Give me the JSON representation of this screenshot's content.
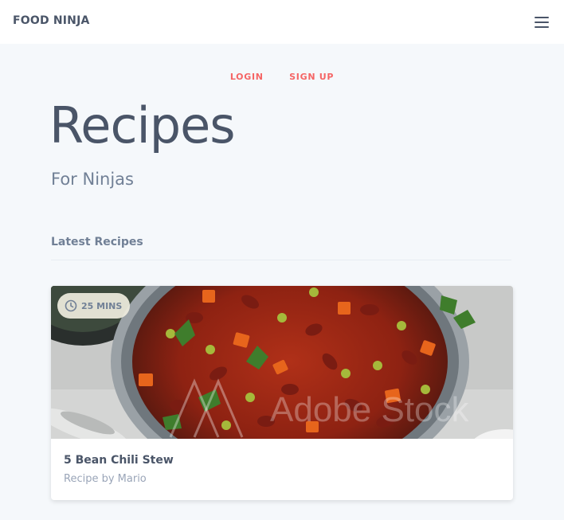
{
  "navbar": {
    "brand": "FOOD NINJA",
    "menu_icon": "hamburger-menu-icon"
  },
  "auth": {
    "login_label": "LOGIN",
    "signup_label": "SIGN UP"
  },
  "hero": {
    "title": "Recipes",
    "subtitle": "For Ninjas"
  },
  "section": {
    "heading": "Latest Recipes"
  },
  "recipes": [
    {
      "time": "25 MINS",
      "time_icon": "clock-icon",
      "title": "5 Bean Chili Stew",
      "author": "Recipe by Mario",
      "watermark": "Adobe Stock"
    }
  ],
  "colors": {
    "accent": "#f56565",
    "text_dark": "#4a5568",
    "text_muted": "#718096",
    "background": "#f5f8fb",
    "navbar_bg": "#ffffff"
  }
}
